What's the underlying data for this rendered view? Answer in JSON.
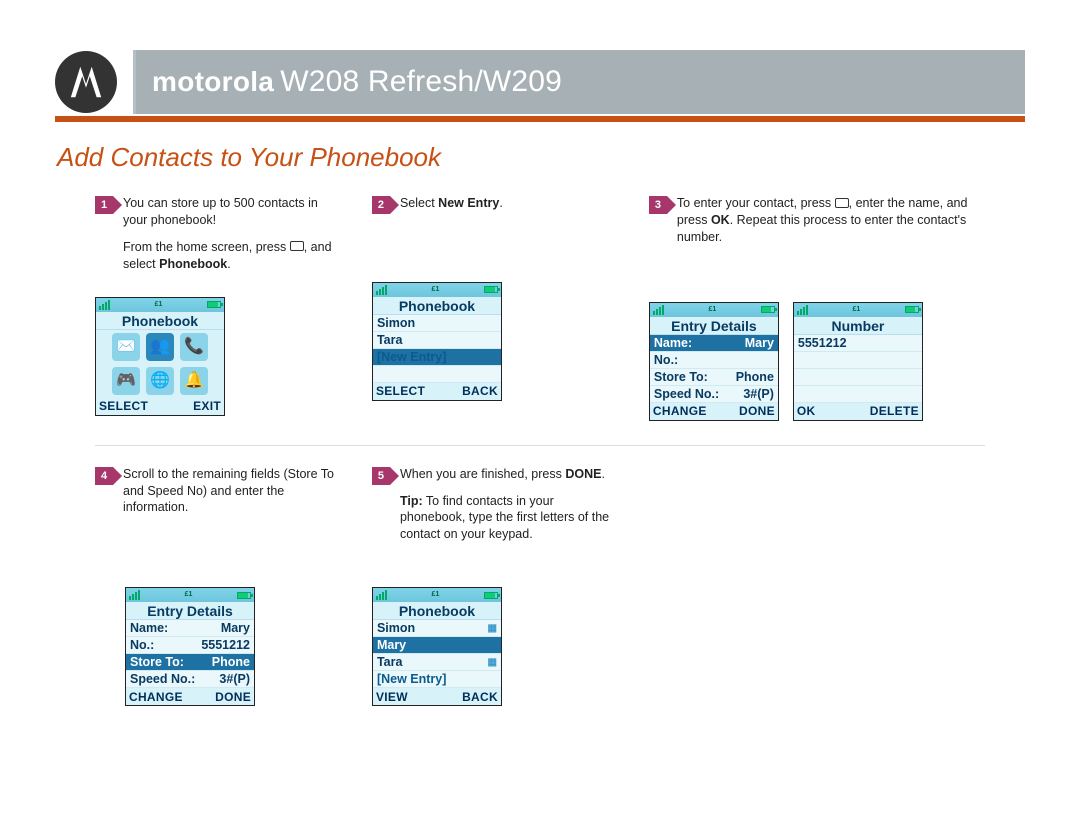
{
  "header": {
    "brand": "motorola",
    "model": "W208 Refresh/W209"
  },
  "section_title": "Add Contacts to Your Phonebook",
  "steps": {
    "s1": {
      "num": "1",
      "p1a": "You can store up to 500 contacts in your phonebook!",
      "p2a": "From the home screen, press ",
      "p2b": ", and select ",
      "p2c": "Phonebook",
      "p2d": "."
    },
    "s2": {
      "num": "2",
      "p1a": "Select ",
      "p1b": "New Entry",
      "p1c": "."
    },
    "s3": {
      "num": "3",
      "p1a": "To enter your contact, press ",
      "p1b": ", enter the name, and press ",
      "p1c": "OK",
      "p1d": ".  Repeat this process to enter the contact's number."
    },
    "s4": {
      "num": "4",
      "p1": "Scroll to the remaining fields (Store To and Speed No) and enter the information."
    },
    "s5": {
      "num": "5",
      "p1a": "When you are finished, press ",
      "p1b": "DONE",
      "p1c": ".",
      "tip_a": "Tip:",
      "tip_b": " To find contacts in your phonebook, type the first letters of the contact on your keypad."
    }
  },
  "screens": {
    "home": {
      "title": "Phonebook",
      "left": "SELECT",
      "right": "EXIT"
    },
    "list1": {
      "title": "Phonebook",
      "i1": "Simon",
      "i2": "Tara",
      "i3": "[New Entry]",
      "left": "SELECT",
      "right": "BACK"
    },
    "entryA": {
      "title": "Entry Details",
      "r1l": "Name:",
      "r1r": "Mary",
      "r2l": "No.:",
      "r2r": "",
      "r3l": "Store To:",
      "r3r": "Phone",
      "r4l": "Speed No.:",
      "r4r": "3#(P)",
      "left": "CHANGE",
      "right": "DONE"
    },
    "number": {
      "title": "Number",
      "r1": "5551212",
      "left": "OK",
      "right": "DELETE"
    },
    "entryB": {
      "title": "Entry Details",
      "r1l": "Name:",
      "r1r": "Mary",
      "r2l": "No.:",
      "r2r": "5551212",
      "r3l": "Store To:",
      "r3r": "Phone",
      "r4l": "Speed No.:",
      "r4r": "3#(P)",
      "left": "CHANGE",
      "right": "DONE"
    },
    "list2": {
      "title": "Phonebook",
      "i1": "Simon",
      "i2": "Mary",
      "i3": "Tara",
      "i4": "[New Entry]",
      "left": "VIEW",
      "right": "BACK"
    }
  }
}
